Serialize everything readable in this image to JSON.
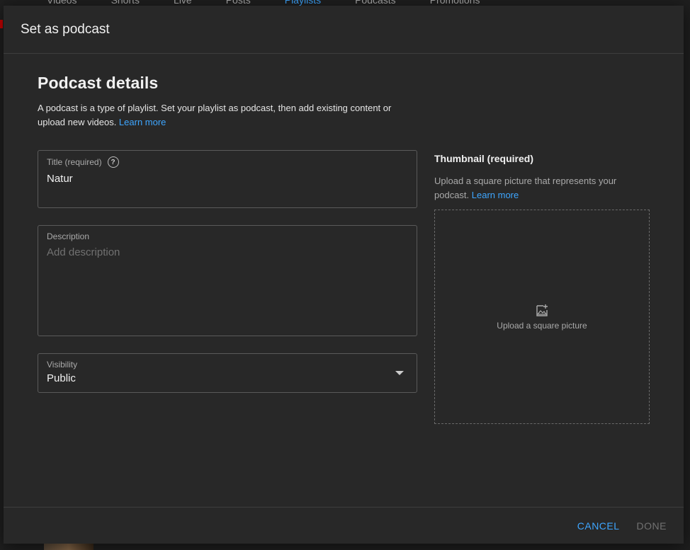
{
  "background": {
    "tabs": [
      "Videos",
      "Shorts",
      "Live",
      "Posts",
      "Playlists",
      "Podcasts",
      "Promotions"
    ],
    "active_tab": "Playlists"
  },
  "dialog": {
    "title": "Set as podcast"
  },
  "details": {
    "heading": "Podcast details",
    "description": "A podcast is a type of playlist. Set your playlist as podcast, then add existing content or upload new videos. ",
    "learn_more": "Learn more"
  },
  "title_field": {
    "label": "Title (required)",
    "value": "Natur",
    "help_glyph": "?"
  },
  "description_field": {
    "label": "Description",
    "placeholder": "Add description"
  },
  "visibility_field": {
    "label": "Visibility",
    "value": "Public"
  },
  "thumbnail": {
    "heading": "Thumbnail (required)",
    "description": "Upload a square picture that represents your podcast. ",
    "learn_more": "Learn more",
    "upload_label": "Upload a square picture",
    "icon": "add-photo-icon"
  },
  "footer": {
    "cancel_label": "CANCEL",
    "done_label": "DONE"
  },
  "colors": {
    "accent": "#3ea6ff",
    "surface": "#282828",
    "disabled": "#717171"
  }
}
